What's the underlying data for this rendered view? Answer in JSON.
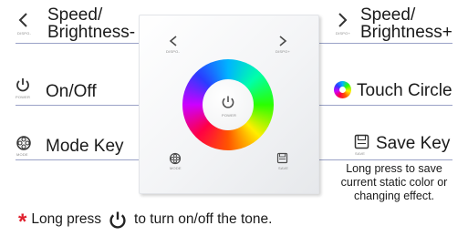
{
  "labels": {
    "speed_left": "Speed/",
    "brightness_minus": "Brightness-",
    "speed_right": "Speed/",
    "brightness_plus": "Brightness+",
    "on_off": "On/Off",
    "touch_circle": "Touch Circle",
    "mode_key": "Mode Key",
    "save_key": "Save Key"
  },
  "icon_captions": {
    "dispo_minus": "DISPO-",
    "dispo_plus": "DISPO+",
    "power": "POWER",
    "mode": "MODE",
    "save": "SAVE"
  },
  "save_note": [
    "Long press to save",
    "current static color or",
    "changing effect."
  ],
  "footer": {
    "asterisk": "*",
    "before": "Long press",
    "after": "to turn on/off the tone."
  },
  "colors": {
    "line": "#9aa2c7",
    "dot": "#6a71a8",
    "asterisk": "#e0202e"
  }
}
